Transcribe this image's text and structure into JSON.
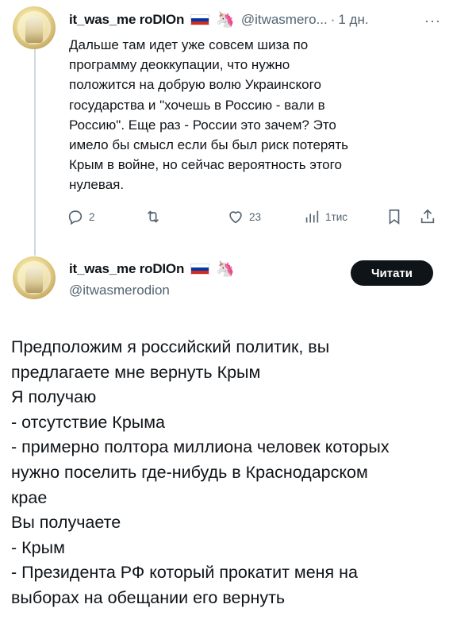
{
  "tweet1": {
    "display_name": "it_was_me roDIOn",
    "handle": "@itwasmero...",
    "separator": "·",
    "time": "1 дн.",
    "more": "···",
    "flag_icon": "russia-flag-icon",
    "emoji_icon": "unicorn-icon",
    "text": "Дальше там идет уже совсем шиза по\nпрограмму деоккупации, что нужно\nположится на добрую волю Украинского\nгосударства и \"хочешь в Россию - вали в\nРоссию\". Еще раз - России это зачем? Это\nимело бы смысл если бы был риск потерять\nКрым в войне, но сейчас вероятность этого\nнулевая.",
    "actions": {
      "reply_count": "2",
      "repost_count": "",
      "like_count": "23",
      "views_count": "1тис"
    }
  },
  "tweet2": {
    "display_name": "it_was_me roDIOn",
    "handle": "@itwasmerodion",
    "read_button": "Читати",
    "lines": [
      "Предположим я российский политик, вы",
      "предлагаете мне вернуть Крым",
      "Я получаю",
      "- отсутствие Крыма",
      "- примерно полтора миллиона человек которых",
      "нужно поселить где-нибудь в Краснодарском",
      "крае",
      "Вы получаете",
      "- Крым",
      "- Президента РФ который прокатит меня на",
      "выборах на обещании его вернуть"
    ]
  },
  "colors": {
    "text": "#0f1419",
    "secondary": "#536471",
    "button_bg": "#0f1419",
    "thread_line": "#cfd9de"
  }
}
